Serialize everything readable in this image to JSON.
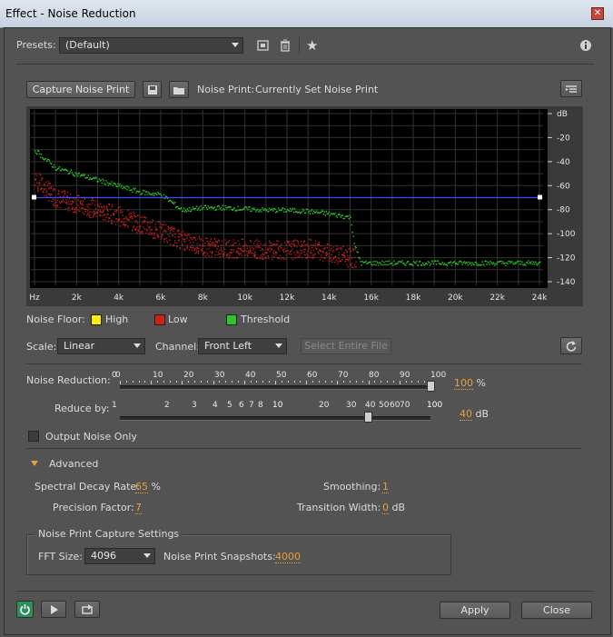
{
  "window": {
    "title": "Effect - Noise Reduction",
    "close_glyph": "✕"
  },
  "presets": {
    "label": "Presets:",
    "value": "(Default)"
  },
  "capture": {
    "button_label": "Capture Noise Print",
    "status_label": "Noise Print:",
    "status_value": "Currently Set Noise Print"
  },
  "graph": {
    "y_ticks": [
      "dB",
      "-20",
      "-40",
      "-60",
      "-80",
      "-100",
      "-120",
      "-140"
    ],
    "x_ticks": [
      "Hz",
      "2k",
      "4k",
      "6k",
      "8k",
      "10k",
      "12k",
      "14k",
      "16k",
      "18k",
      "20k",
      "22k",
      "24k"
    ],
    "colors": {
      "low": "#d02020",
      "threshold": "#28c828",
      "high": "#ffee00",
      "line": "#3a50ff"
    }
  },
  "chart_data": {
    "type": "scatter",
    "xlabel": "",
    "ylabel": "dB",
    "xlim_khz": [
      0,
      24
    ],
    "ylim_db": [
      -140,
      0
    ],
    "series": [
      {
        "name": "Threshold",
        "x_khz": [
          0,
          1,
          2,
          3,
          4,
          5,
          6,
          7,
          8,
          9,
          10,
          11,
          12,
          13,
          14,
          15,
          15.2,
          15.5,
          16,
          18,
          20,
          22,
          24
        ],
        "db": [
          -30,
          -45,
          -50,
          -55,
          -60,
          -65,
          -67,
          -80,
          -78,
          -78,
          -79,
          -80,
          -80,
          -81,
          -83,
          -86,
          -110,
          -124,
          -124,
          -124,
          -124,
          -124,
          -124
        ]
      },
      {
        "name": "Low",
        "x_khz": [
          0,
          1,
          2,
          3,
          4,
          5,
          6,
          7,
          8,
          9,
          10,
          11,
          12,
          13,
          14,
          15
        ],
        "db": [
          -55,
          -70,
          -75,
          -80,
          -85,
          -92,
          -98,
          -105,
          -110,
          -112,
          -112,
          -113,
          -113,
          -112,
          -115,
          -120
        ]
      }
    ],
    "reference_line_db": -70
  },
  "legend": {
    "label": "Noise Floor:",
    "high": "High",
    "low": "Low",
    "threshold": "Threshold"
  },
  "scale": {
    "label": "Scale:",
    "value": "Linear"
  },
  "channel": {
    "label": "Channel:",
    "value": "Front Left"
  },
  "select_entire_file": "Select Entire File",
  "noise_reduction": {
    "label": "Noise Reduction:",
    "ticks": [
      "0",
      "0",
      "10",
      "20",
      "30",
      "40",
      "50",
      "60",
      "70",
      "80",
      "90",
      "100"
    ],
    "value": "100",
    "unit": "%",
    "percent": 100
  },
  "reduce_by": {
    "label": "Reduce by:",
    "ticks": [
      "1",
      "2",
      "3",
      "4",
      "5",
      "6",
      "7",
      "8",
      "10",
      "20",
      "30",
      "40",
      "50",
      "60",
      "70",
      "100"
    ],
    "value": "40",
    "unit": "dB"
  },
  "output_noise_only": "Output Noise Only",
  "advanced": {
    "label": "Advanced",
    "spectral_decay_label": "Spectral Decay Rate:",
    "spectral_decay_value": "65",
    "spectral_decay_unit": "%",
    "smoothing_label": "Smoothing:",
    "smoothing_value": "1",
    "precision_label": "Precision Factor:",
    "precision_value": "7",
    "transition_label": "Transition Width:",
    "transition_value": "0",
    "transition_unit": "dB"
  },
  "capture_settings": {
    "legend": "Noise Print Capture Settings",
    "fft_label": "FFT Size:",
    "fft_value": "4096",
    "snapshots_label": "Noise Print Snapshots:",
    "snapshots_value": "4000"
  },
  "footer": {
    "apply": "Apply",
    "close": "Close"
  },
  "icons": [
    "save-preset-icon",
    "delete-preset-icon",
    "favorite-star-icon",
    "info-icon",
    "save-noise-print-icon",
    "open-folder-icon",
    "graph-menu-icon",
    "reset-icon",
    "power-icon",
    "play-icon",
    "loop-icon"
  ]
}
